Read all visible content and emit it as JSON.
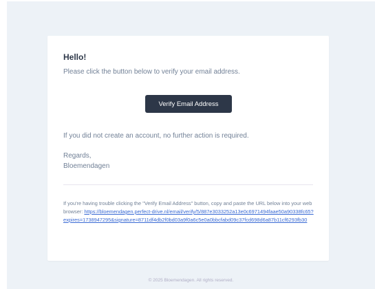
{
  "email": {
    "greeting": "Hello!",
    "intro": "Please click the button below to verify your email address.",
    "button_label": "Verify Email Address",
    "no_action": "If you did not create an account, no further action is required.",
    "regards": "Regards,",
    "sender": "Bloemendagen",
    "subcopy_text": "If you're having trouble clicking the \"Verify Email Address\" button, copy and paste the URL below into your web browser: ",
    "verify_link": "https://bloemendagen.perfect-drive.nl/email/verify/5/887e3033252a13e0c6971494faae50a90338fc65?expires=1738947295&signature=8711df4db2f0bd03a9f0a6c5e0a0bbcfabd09c37fcd698d6a87b11cf6293fb30"
  },
  "footer": {
    "copyright": "© 2025 Bloemendagen. All rights reserved."
  },
  "colors": {
    "background": "#edf2f7",
    "card": "#ffffff",
    "button": "#2d3748",
    "heading": "#2d3748",
    "body_text": "#718096",
    "link": "#3869d4"
  }
}
